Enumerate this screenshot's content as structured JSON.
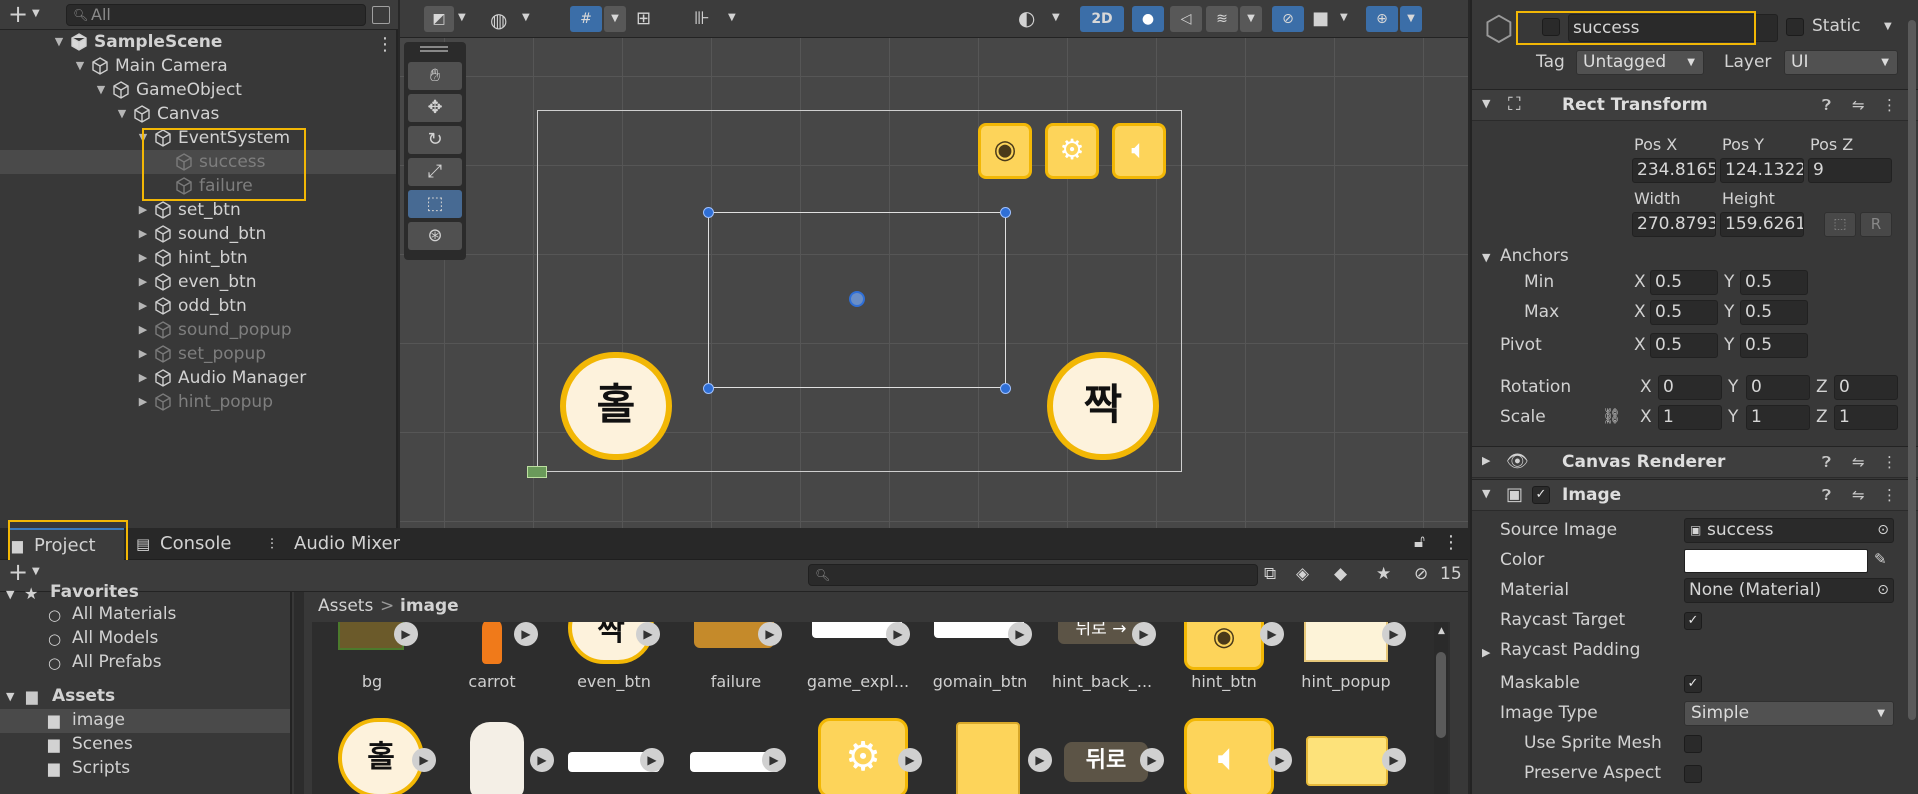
{
  "hierarchy": {
    "search_placeholder": "All",
    "items": [
      {
        "label": "SampleScene",
        "depth": 0,
        "arrow": "▼",
        "kind": "scene"
      },
      {
        "label": "Main Camera",
        "depth": 1,
        "arrow": "▼",
        "kind": "go"
      },
      {
        "label": "GameObject",
        "depth": 2,
        "arrow": "▼",
        "kind": "go"
      },
      {
        "label": "Canvas",
        "depth": 3,
        "arrow": "▼",
        "kind": "go"
      },
      {
        "label": "EventSystem",
        "depth": 4,
        "arrow": "▼",
        "kind": "go"
      },
      {
        "label": "success",
        "depth": 5,
        "arrow": "",
        "kind": "go",
        "dim": true,
        "selected": true
      },
      {
        "label": "failure",
        "depth": 5,
        "arrow": "",
        "kind": "go",
        "dim": true
      },
      {
        "label": "set_btn",
        "depth": 4,
        "arrow": "▶",
        "kind": "go"
      },
      {
        "label": "sound_btn",
        "depth": 4,
        "arrow": "▶",
        "kind": "go"
      },
      {
        "label": "hint_btn",
        "depth": 4,
        "arrow": "▶",
        "kind": "go"
      },
      {
        "label": "even_btn",
        "depth": 4,
        "arrow": "▶",
        "kind": "go"
      },
      {
        "label": "odd_btn",
        "depth": 4,
        "arrow": "▶",
        "kind": "go"
      },
      {
        "label": "sound_popup",
        "depth": 4,
        "arrow": "▶",
        "kind": "go",
        "dim": true
      },
      {
        "label": "set_popup",
        "depth": 4,
        "arrow": "▶",
        "kind": "go",
        "dim": true
      },
      {
        "label": "Audio Manager",
        "depth": 4,
        "arrow": "▶",
        "kind": "go"
      },
      {
        "label": "hint_popup",
        "depth": 4,
        "arrow": "▶",
        "kind": "go",
        "dim": true
      }
    ]
  },
  "scene": {
    "toolbar": {
      "mode_2d": "2D"
    },
    "odd_label": "홀",
    "even_label": "짝"
  },
  "inspector": {
    "object_name": "success",
    "static_label": "Static",
    "tag_label": "Tag",
    "tag_value": "Untagged",
    "layer_label": "Layer",
    "layer_value": "UI",
    "rect_transform": {
      "title": "Rect Transform",
      "pos_x_label": "Pos X",
      "pos_y_label": "Pos Y",
      "pos_z_label": "Pos Z",
      "pos_x": "234.8165",
      "pos_y": "124.1322",
      "pos_z": "9",
      "width_label": "Width",
      "height_label": "Height",
      "width": "270.8793",
      "height": "159.6261",
      "r_btn": "R",
      "anchors_label": "Anchors",
      "min_label": "Min",
      "max_label": "Max",
      "min_x": "0.5",
      "min_y": "0.5",
      "max_x": "0.5",
      "max_y": "0.5",
      "pivot_label": "Pivot",
      "pivot_x": "0.5",
      "pivot_y": "0.5",
      "rotation_label": "Rotation",
      "rot_x": "0",
      "rot_y": "0",
      "rot_z": "0",
      "scale_label": "Scale",
      "scale_x": "1",
      "scale_y": "1",
      "scale_z": "1",
      "x": "X",
      "y": "Y",
      "z": "Z"
    },
    "canvas_renderer": {
      "title": "Canvas Renderer"
    },
    "image": {
      "title": "Image",
      "source_image_label": "Source Image",
      "source_image": "success",
      "color_label": "Color",
      "color_value": "#ffffff",
      "material_label": "Material",
      "material": "None (Material)",
      "raycast_target_label": "Raycast Target",
      "raycast_padding_label": "Raycast Padding",
      "maskable_label": "Maskable",
      "image_type_label": "Image Type",
      "image_type": "Simple",
      "use_sprite_mesh_label": "Use Sprite Mesh",
      "preserve_aspect_label": "Preserve Aspect"
    }
  },
  "bottom": {
    "tabs": [
      "Project",
      "Console",
      "Audio Mixer"
    ],
    "visibility_count": "15",
    "favorites_label": "Favorites",
    "favorites": [
      "All Materials",
      "All Models",
      "All Prefabs"
    ],
    "assets_label": "Assets",
    "folders": [
      "image",
      "Scenes",
      "Scripts"
    ],
    "breadcrumb_root": "Assets",
    "breadcrumb_sep": ">",
    "breadcrumb_current": "image",
    "assets_row1": [
      "bg",
      "carrot",
      "even_btn",
      "failure",
      "game_expl...",
      "gomain_btn",
      "hint_back_...",
      "hint_btn",
      "hint_popup"
    ],
    "thumb_text": {
      "even": "짝",
      "hint_back": "뒤로 →",
      "back": "뒤로",
      "odd": "홀"
    }
  },
  "colors": {
    "accent": "#f2b705",
    "button_yellow": "#fdd45a",
    "selection": "#3a79bb"
  }
}
